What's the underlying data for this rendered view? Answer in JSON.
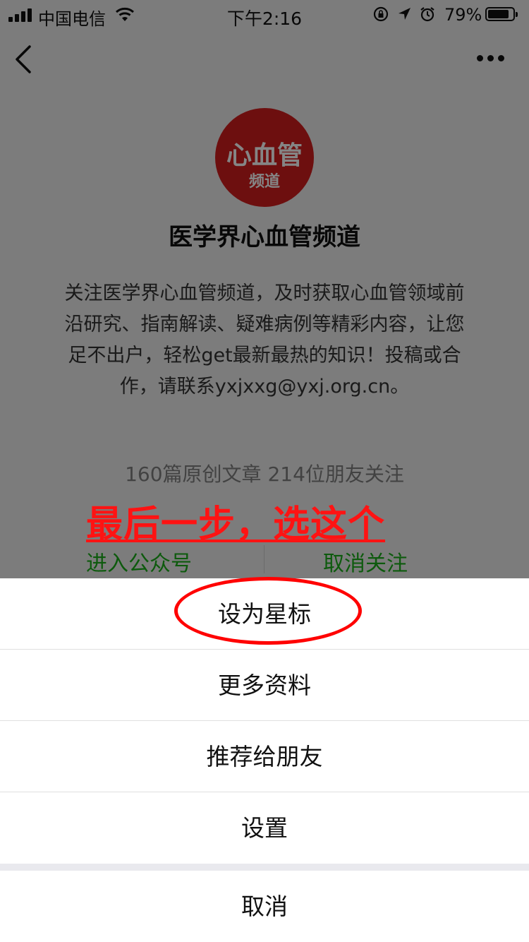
{
  "status_bar": {
    "carrier": "中国电信",
    "time": "下午2:16",
    "battery": "79%",
    "icons": [
      "signal-icon",
      "wifi-icon",
      "orientation-lock-icon",
      "location-icon",
      "alarm-icon",
      "battery-icon"
    ]
  },
  "nav": {
    "back_icon": "chevron-left-icon",
    "more_icon": "more-dots-icon"
  },
  "profile": {
    "avatar_text_main": "心血管",
    "avatar_text_sub": "频道",
    "name": "医学界心血管频道",
    "description": "关注医学界心血管频道，及时获取心血管领域前沿研究、指南解读、疑难病例等精彩内容，让您足不出户，轻松get最新最热的知识！投稿或合作，请联系yxjxxg@yxj.org.cn。",
    "stats": "160篇原创文章  214位朋友关注"
  },
  "annotation": "最后一步，选这个",
  "actions": {
    "enter": "进入公众号",
    "unfollow": "取消关注"
  },
  "sheet": {
    "items": [
      {
        "label": "设为星标"
      },
      {
        "label": "更多资料"
      },
      {
        "label": "推荐给朋友"
      },
      {
        "label": "设置"
      }
    ],
    "cancel": "取消"
  },
  "colors": {
    "accent_green": "#1aad19",
    "annotation_red": "#ff1313",
    "avatar_red": "#d21e1e"
  }
}
